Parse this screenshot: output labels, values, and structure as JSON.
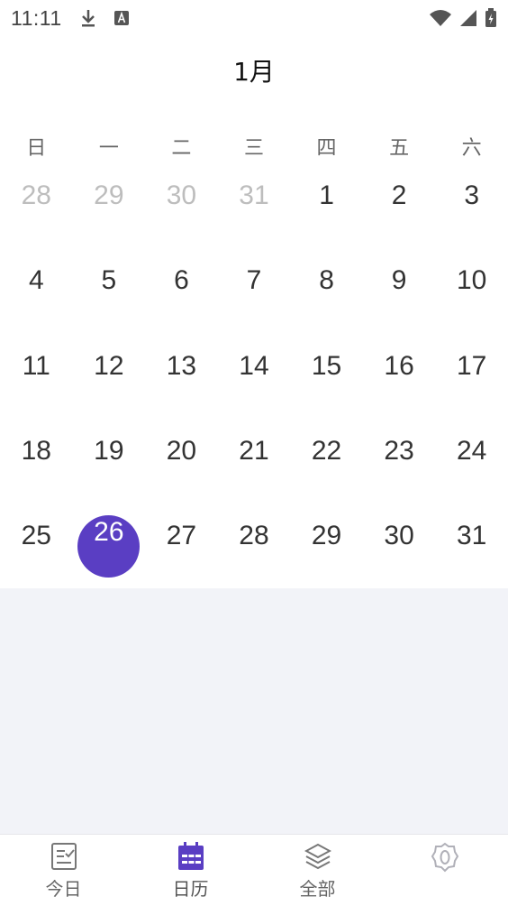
{
  "status_bar": {
    "time": "11:11",
    "icons": [
      "download-icon",
      "text-a-icon",
      "wifi-icon",
      "signal-icon",
      "battery-icon"
    ]
  },
  "calendar": {
    "month_title": "1月",
    "weekdays": [
      "日",
      "一",
      "二",
      "三",
      "四",
      "五",
      "六"
    ],
    "days": [
      {
        "label": "28",
        "muted": true
      },
      {
        "label": "29",
        "muted": true
      },
      {
        "label": "30",
        "muted": true
      },
      {
        "label": "31",
        "muted": true
      },
      {
        "label": "1"
      },
      {
        "label": "2"
      },
      {
        "label": "3"
      },
      {
        "label": "4"
      },
      {
        "label": "5"
      },
      {
        "label": "6"
      },
      {
        "label": "7"
      },
      {
        "label": "8"
      },
      {
        "label": "9"
      },
      {
        "label": "10"
      },
      {
        "label": "11"
      },
      {
        "label": "12"
      },
      {
        "label": "13"
      },
      {
        "label": "14"
      },
      {
        "label": "15"
      },
      {
        "label": "16"
      },
      {
        "label": "17"
      },
      {
        "label": "18"
      },
      {
        "label": "19"
      },
      {
        "label": "20"
      },
      {
        "label": "21"
      },
      {
        "label": "22"
      },
      {
        "label": "23"
      },
      {
        "label": "24"
      },
      {
        "label": "25"
      },
      {
        "label": "26",
        "selected": true
      },
      {
        "label": "27"
      },
      {
        "label": "28"
      },
      {
        "label": "29"
      },
      {
        "label": "30"
      },
      {
        "label": "31"
      }
    ],
    "selected_color": "#5a3ec3"
  },
  "bottom_nav": {
    "items": [
      {
        "label": "今日",
        "icon": "checklist-icon",
        "active": false
      },
      {
        "label": "日历",
        "icon": "calendar-icon",
        "active": true
      },
      {
        "label": "全部",
        "icon": "layers-icon",
        "active": false
      },
      {
        "label": "",
        "icon": "badge-icon",
        "active": false
      }
    ],
    "accent_color": "#5a3ec3"
  }
}
